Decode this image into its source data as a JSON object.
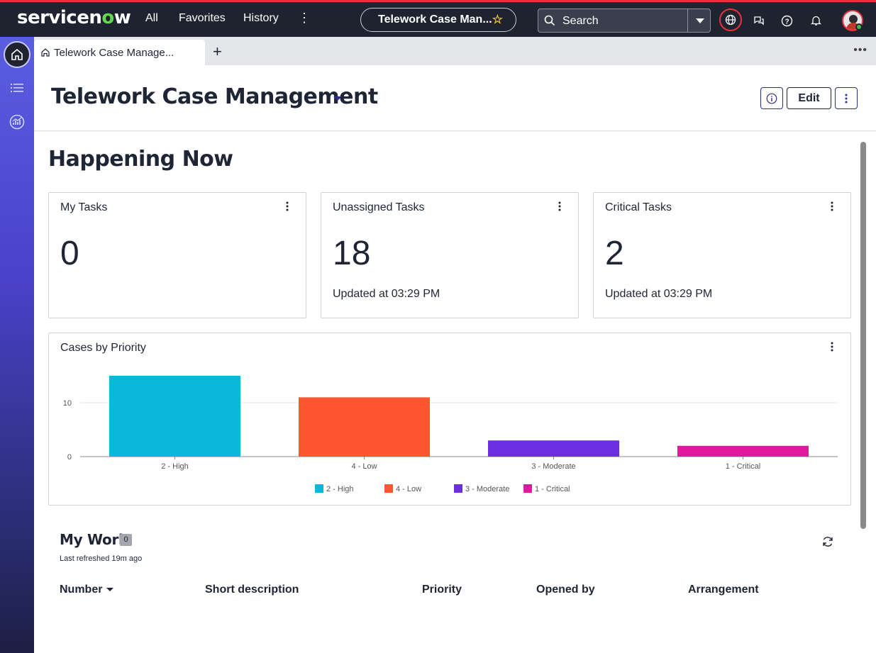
{
  "topbar": {
    "brand_prefix": "servicen",
    "brand_o": "o",
    "brand_suffix": "w",
    "nav_all": "All",
    "nav_favorites": "Favorites",
    "nav_history": "History",
    "current_app": "Telework Case Man...",
    "search_label": "Search"
  },
  "tabs": {
    "active_label": "Telework Case Manage...",
    "add_label": "+"
  },
  "header": {
    "title": "Telework Case Management",
    "edit_label": "Edit"
  },
  "main": {
    "section_title": "Happening Now",
    "cards": [
      {
        "title": "My Tasks",
        "value": "0",
        "updated": ""
      },
      {
        "title": "Unassigned Tasks",
        "value": "18",
        "updated": "Updated at 03:29 PM"
      },
      {
        "title": "Critical Tasks",
        "value": "2",
        "updated": "Updated at 03:29 PM"
      }
    ],
    "chart_title": "Cases by Priority"
  },
  "chart_data": {
    "type": "bar",
    "title": "Cases by Priority",
    "categories": [
      "2 - High",
      "4 - Low",
      "3 - Moderate",
      "1 - Critical"
    ],
    "values": [
      15,
      11,
      3,
      2
    ],
    "colors": [
      "#0bb8dc",
      "#ff5530",
      "#6b2fe0",
      "#e0199f"
    ],
    "yticks": [
      0,
      10
    ],
    "ylim": [
      0,
      15
    ],
    "grid": true,
    "legend": "bottom",
    "xlabel": "",
    "ylabel": ""
  },
  "mywork": {
    "title": "My Work",
    "count": "0",
    "refreshed": "Last refreshed 19m ago",
    "columns": [
      "Number",
      "Short description",
      "Priority",
      "Opened by",
      "Arrangement"
    ]
  }
}
